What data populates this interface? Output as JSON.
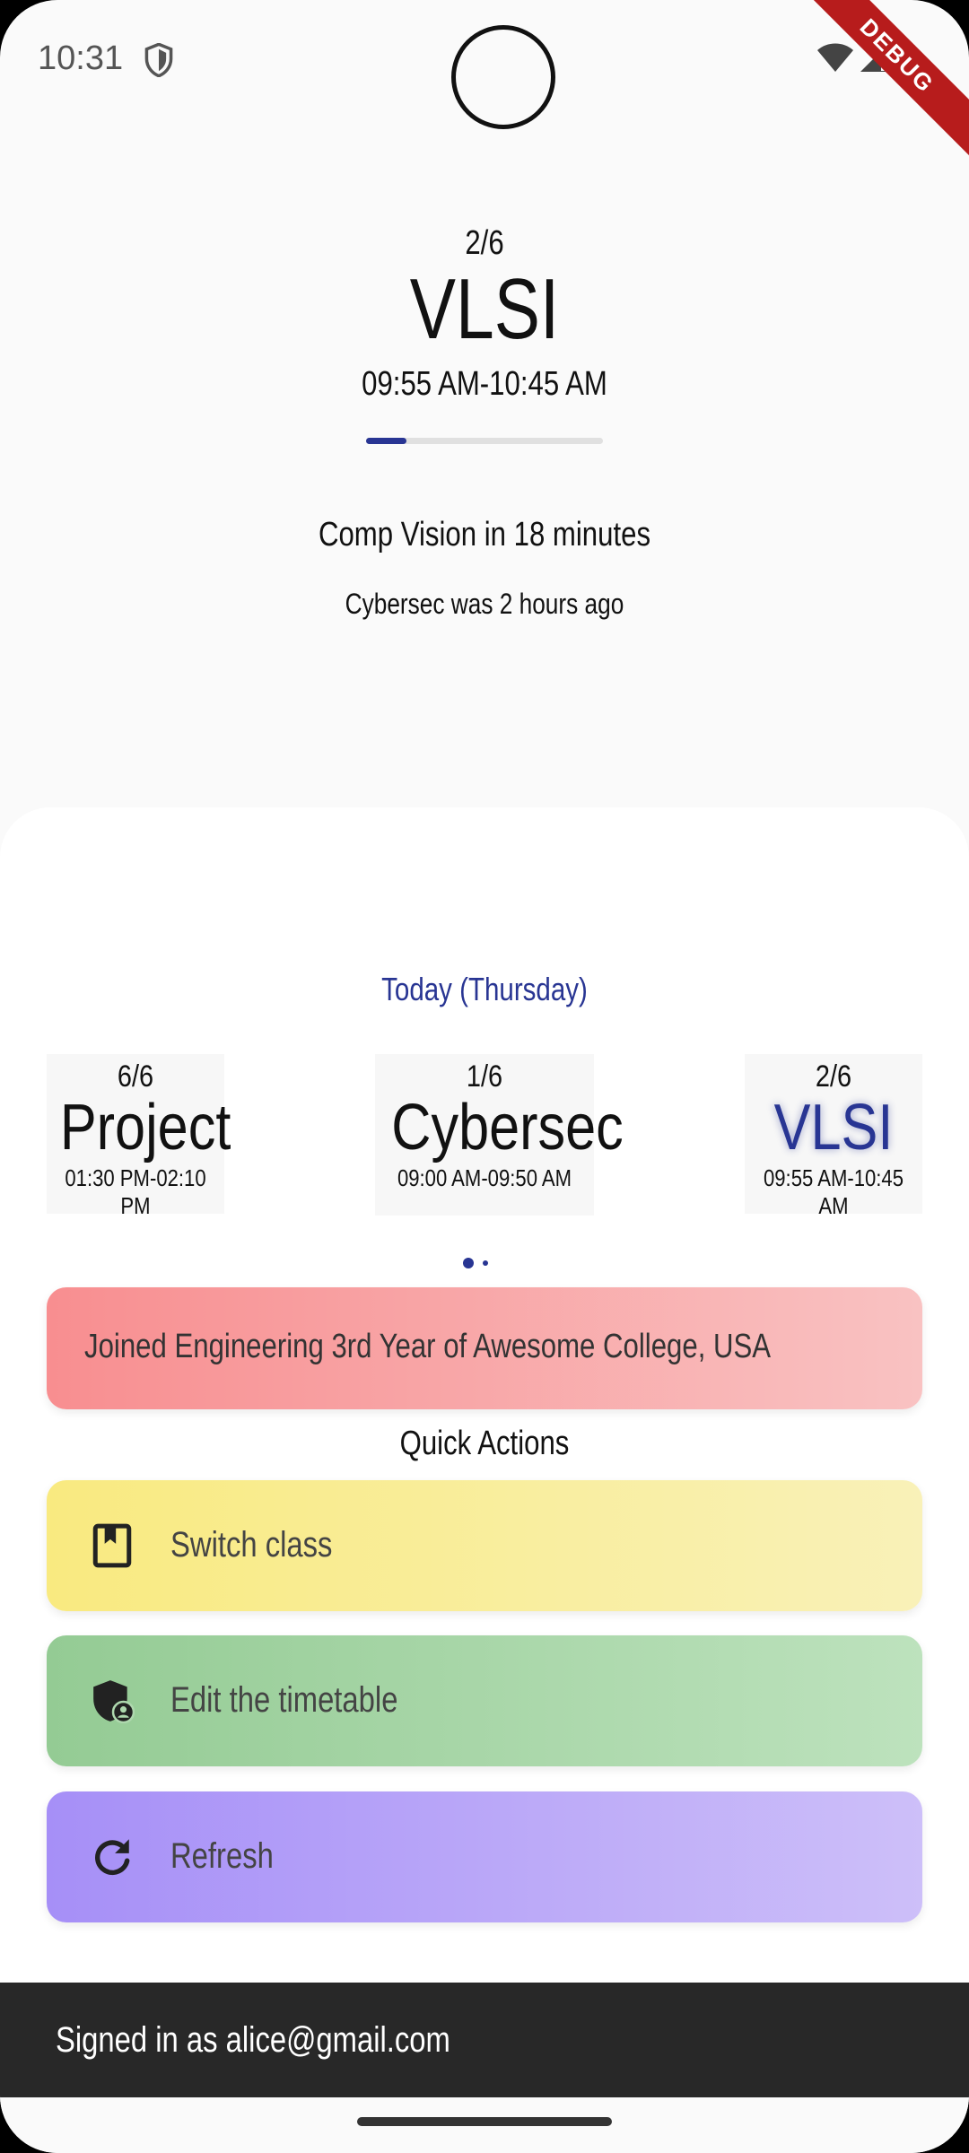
{
  "status_bar": {
    "time": "10:31",
    "debug_label": "DEBUG",
    "icons": [
      "shield-icon",
      "wifi-icon",
      "signal-icon",
      "battery-icon"
    ]
  },
  "current_class": {
    "index": "2/6",
    "name": "VLSI",
    "time": "09:55 AM-10:45 AM",
    "progress": 0.17
  },
  "next_class_text": "Comp Vision in 18 minutes",
  "previous_class_text": "Cybersec was 2 hours ago",
  "today": {
    "label": "Today (Thursday)",
    "classes": [
      {
        "index": "6/6",
        "name": "Project",
        "time": "01:30 PM-02:10 PM"
      },
      {
        "index": "1/6",
        "name": "Cybersec",
        "time": "09:00 AM-09:50 AM"
      },
      {
        "index": "2/6",
        "name": "VLSI",
        "time": "09:55 AM-10:45 AM"
      }
    ]
  },
  "joined_text": "Joined Engineering 3rd Year of Awesome College, USA",
  "quick_actions": {
    "title": "Quick Actions",
    "items": [
      {
        "label": "Switch class",
        "icon": "bookmark-book-icon"
      },
      {
        "label": "Edit the timetable",
        "icon": "admin-shield-icon"
      },
      {
        "label": "Refresh",
        "icon": "refresh-icon"
      }
    ]
  },
  "footer": {
    "signed_in_text": "Signed in as alice@gmail.com"
  },
  "colors": {
    "accent": "#283593",
    "banner": "#f88e90",
    "switch": "#f9ea80",
    "edit": "#94cb94",
    "refresh": "#a68ff7",
    "footer": "#282828"
  }
}
